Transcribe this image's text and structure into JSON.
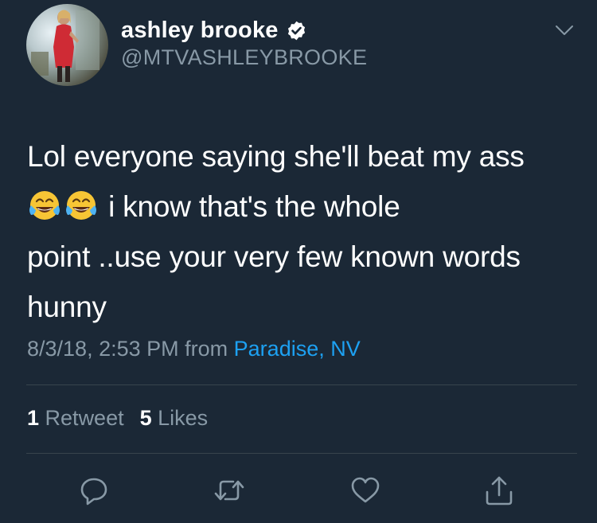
{
  "user": {
    "display_name": "ashley brooke",
    "handle": "@MTVASHLEYBROOKE",
    "verified": true,
    "avatar_icon": "profile-photo"
  },
  "tweet": {
    "line1": "Lol everyone saying she'll beat my ass",
    "line2_emoji": [
      "😂",
      "😂"
    ],
    "line2_text": " i know that's the whole",
    "line3": "point ..use your very few known words",
    "line4": "hunny"
  },
  "meta": {
    "timestamp": "8/3/18, 2:53 PM",
    "from_label": "from",
    "location": "Paradise, NV"
  },
  "stats": {
    "retweets_count": "1",
    "retweets_label": "Retweet",
    "likes_count": "5",
    "likes_label": "Likes"
  },
  "actions": {
    "reply_icon": "reply-icon",
    "retweet_icon": "retweet-icon",
    "like_icon": "heart-icon",
    "share_icon": "share-icon"
  },
  "colors": {
    "background": "#1b2836",
    "secondary_text": "#8899a6",
    "link": "#1da1f2",
    "divider": "#38444d"
  }
}
